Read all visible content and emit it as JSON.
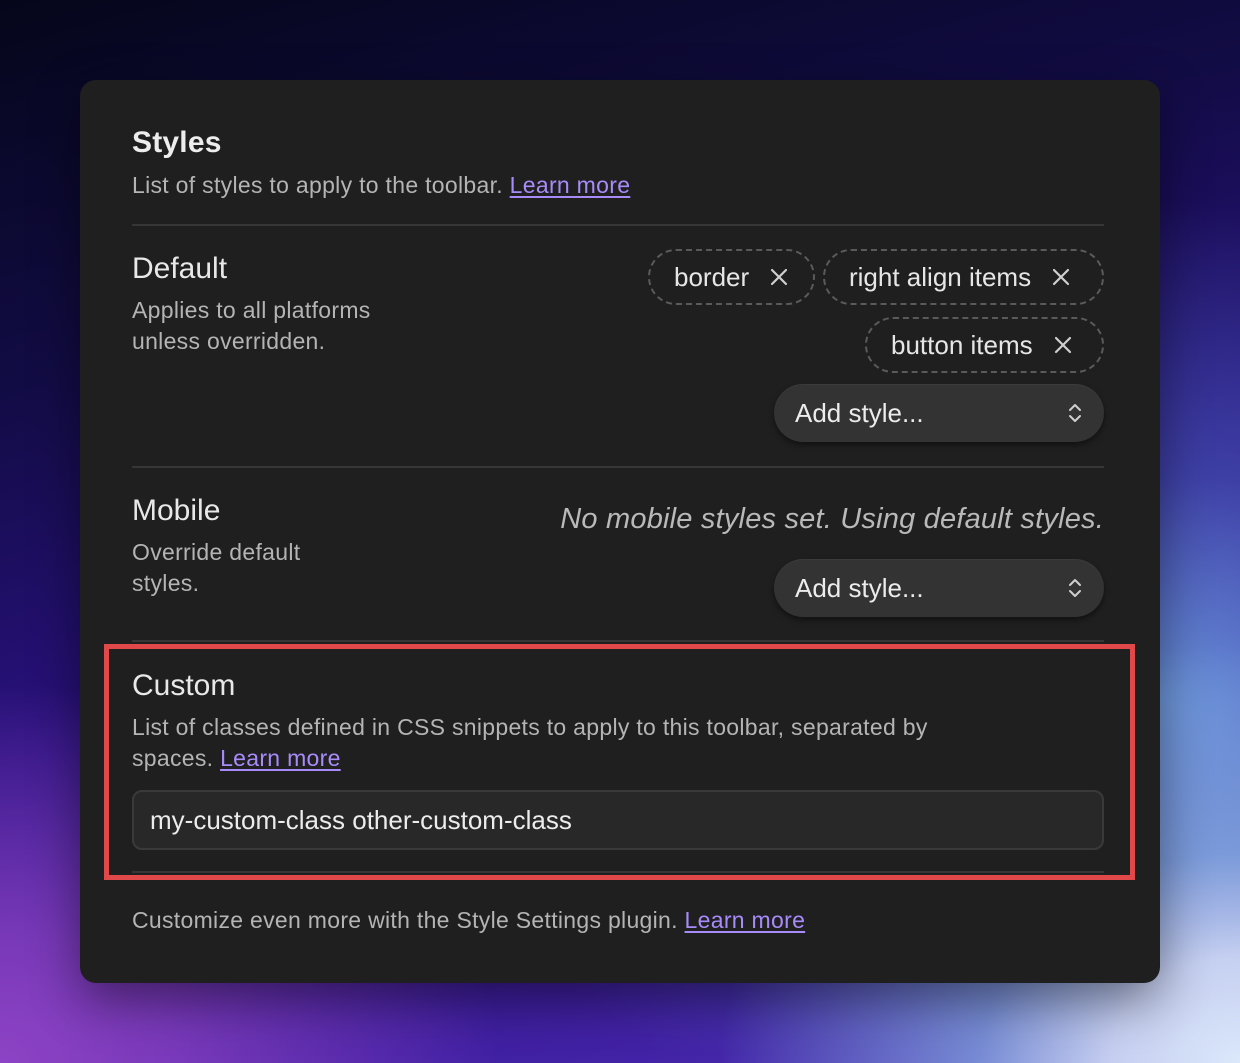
{
  "colors": {
    "panel_background": "#1f1f1f",
    "link": "#a88bfa",
    "highlight_border": "#e0484a"
  },
  "styles_section": {
    "title": "Styles",
    "description": "List of styles to apply to the toolbar.",
    "learn_more": "Learn more"
  },
  "default_setting": {
    "name": "Default",
    "description_line1": "Applies to all platforms",
    "description_line2": "unless overridden.",
    "chips": [
      {
        "label": "border",
        "remove_icon": "close-icon"
      },
      {
        "label": "right align items",
        "remove_icon": "close-icon"
      },
      {
        "label": "button items",
        "remove_icon": "close-icon"
      }
    ],
    "add_style_select": {
      "value": "Add style...",
      "icon": "chevron-up-down-icon"
    }
  },
  "mobile_setting": {
    "name": "Mobile",
    "description_line1": "Override default",
    "description_line2": "styles.",
    "empty_note": "No mobile styles set. Using default styles.",
    "add_style_select": {
      "value": "Add style...",
      "icon": "chevron-up-down-icon"
    }
  },
  "custom_setting": {
    "name": "Custom",
    "description_line1": "List of classes defined in CSS snippets to apply to this toolbar, separated by",
    "description_line2": "spaces.",
    "learn_more": "Learn more",
    "input_value": "my-custom-class other-custom-class"
  },
  "footer": {
    "text": "Customize even more with the Style Settings plugin.",
    "learn_more": "Learn more"
  }
}
